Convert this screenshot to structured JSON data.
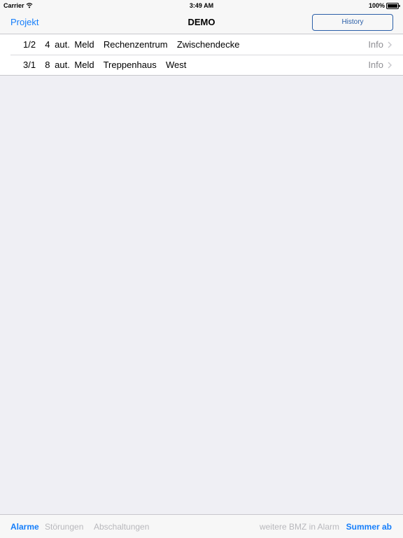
{
  "status_bar": {
    "carrier": "Carrier",
    "time": "3:49 AM",
    "battery": "100%"
  },
  "nav_bar": {
    "back_label": "Projekt",
    "title": "DEMO",
    "history_label": "History"
  },
  "rows": [
    {
      "text": "1/2  4 aut. Meld  Rechenzentrum  Zwischendecke",
      "info": "Info"
    },
    {
      "text": "3/1  8 aut. Meld  Treppenhaus  West",
      "info": "Info"
    }
  ],
  "tab_bar": {
    "alarme": "Alarme",
    "stoerungen": "Störungen",
    "abschaltungen": "Abschaltungen",
    "weitere": "weitere BMZ in Alarm",
    "summer": "Summer ab"
  },
  "colors": {
    "accent": "#157efb",
    "inactive": "#b8b8bc",
    "background": "#efeff4"
  },
  "icons": [
    "wifi-icon",
    "battery-icon",
    "chevron-right-icon"
  ]
}
